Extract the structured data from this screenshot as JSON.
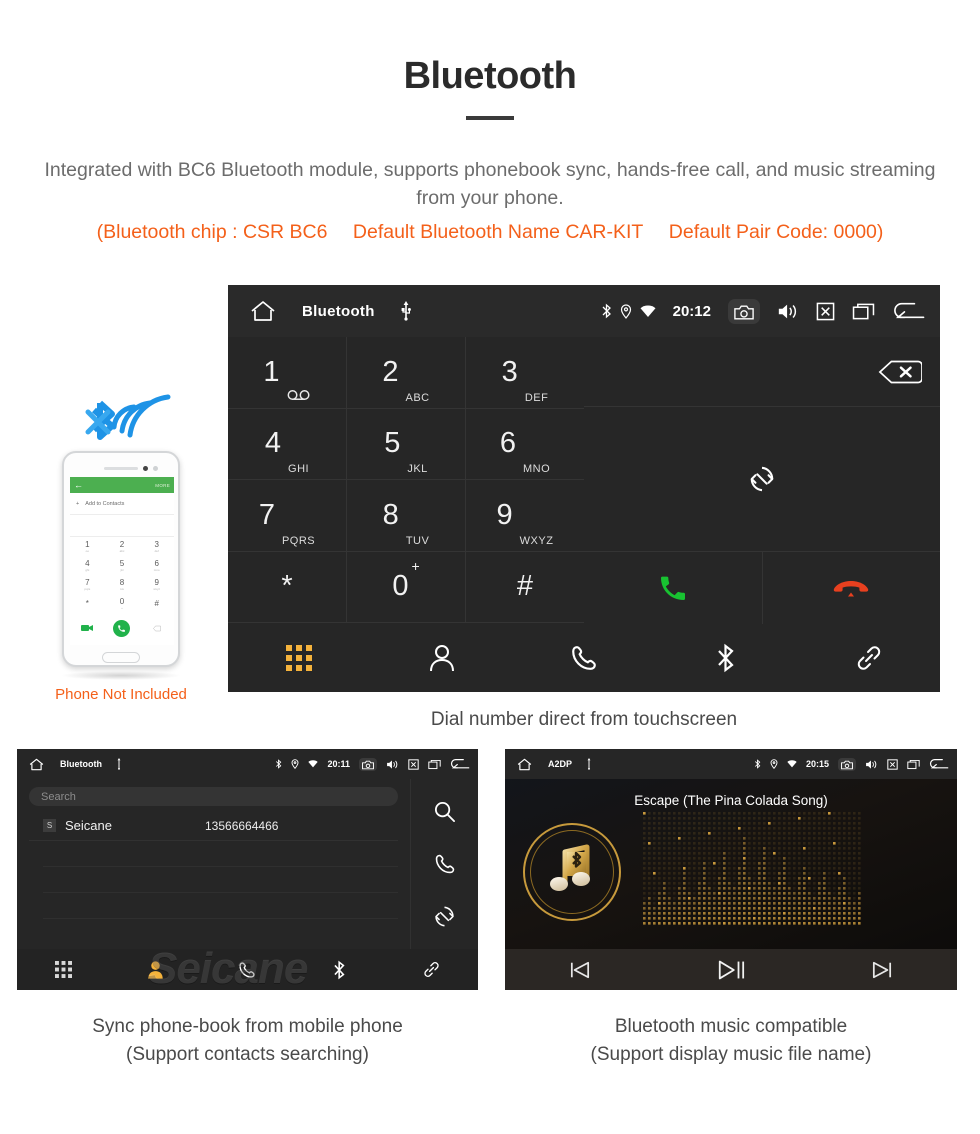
{
  "header": {
    "title": "Bluetooth",
    "subtitle": "Integrated with BC6 Bluetooth module, supports phonebook sync, hands-free call, and music streaming from your phone.",
    "note_chip": "(Bluetooth chip : CSR BC6",
    "note_name": "Default Bluetooth Name CAR-KIT",
    "note_pair": "Default Pair Code: 0000)",
    "accent_color": "#f4601a",
    "text_color": "#6c6c6c"
  },
  "main_unit": {
    "statusbar": {
      "home_icon": "home-icon",
      "title": "Bluetooth",
      "usb_icon": "usb-icon",
      "bluetooth_icon": "bluetooth-icon",
      "location_icon": "location-icon",
      "wifi_icon": "wifi-icon",
      "time": "20:12",
      "camera_icon": "camera-icon",
      "volume_icon": "speaker-icon",
      "close_icon": "close-box-icon",
      "recents_icon": "recents-icon",
      "back_icon": "back-arrow-icon"
    },
    "keys": [
      {
        "num": "1",
        "sub": "",
        "voicemail": true
      },
      {
        "num": "2",
        "sub": "ABC"
      },
      {
        "num": "3",
        "sub": "DEF"
      },
      {
        "num": "4",
        "sub": "GHI"
      },
      {
        "num": "5",
        "sub": "JKL"
      },
      {
        "num": "6",
        "sub": "MNO"
      },
      {
        "num": "7",
        "sub": "PQRS"
      },
      {
        "num": "8",
        "sub": "TUV"
      },
      {
        "num": "9",
        "sub": "WXYZ"
      },
      {
        "num": "*",
        "sub": ""
      },
      {
        "num": "0",
        "sub": "",
        "plus": "+"
      },
      {
        "num": "#",
        "sub": ""
      }
    ],
    "right_pad": {
      "backspace_icon": "backspace-icon",
      "sync_icon": "sync-icon",
      "call_icon": "call-icon",
      "hangup_icon": "hangup-icon",
      "call_color": "#18c231",
      "hangup_color": "#e8401f"
    },
    "tabs": [
      {
        "name": "dialpad",
        "icon": "dialpad-icon",
        "active": true
      },
      {
        "name": "contacts",
        "icon": "person-icon",
        "active": false
      },
      {
        "name": "call-log",
        "icon": "phone-icon",
        "active": false
      },
      {
        "name": "bluetooth",
        "icon": "bluetooth-icon",
        "active": false
      },
      {
        "name": "link",
        "icon": "link-icon",
        "active": false
      }
    ],
    "active_color": "#f5b33c",
    "caption": "Dial number direct from touchscreen"
  },
  "phone_mockup": {
    "bluetooth_wave_color": "#1e93e6",
    "app_back_icon": "back-icon",
    "app_more_label": "MORE",
    "add_contacts_label": "Add to Contacts",
    "add_icon": "plus-icon",
    "keys": [
      {
        "num": "1",
        "sub": "oo"
      },
      {
        "num": "2",
        "sub": "abc"
      },
      {
        "num": "3",
        "sub": "def"
      },
      {
        "num": "4",
        "sub": "ghi"
      },
      {
        "num": "5",
        "sub": "jkl"
      },
      {
        "num": "6",
        "sub": "mno"
      },
      {
        "num": "7",
        "sub": "pqrs"
      },
      {
        "num": "8",
        "sub": "tuv"
      },
      {
        "num": "9",
        "sub": "wxyz"
      },
      {
        "num": "*",
        "sub": ""
      },
      {
        "num": "0",
        "sub": "+"
      },
      {
        "num": "#",
        "sub": ""
      }
    ],
    "caption": "Phone Not Included",
    "caption_color": "#f4601a"
  },
  "bottom_left": {
    "statusbar": {
      "home_icon": "home-icon",
      "title": "Bluetooth",
      "usb_icon": "usb-icon",
      "time": "20:11",
      "camera_icon": "camera-icon",
      "volume_icon": "speaker-icon",
      "close_icon": "close-box-icon",
      "recents_icon": "recents-icon",
      "back_icon": "back-arrow-icon"
    },
    "search_placeholder": "Search",
    "contacts": [
      {
        "initial": "S",
        "name": "Seicane",
        "number": "13566664466"
      }
    ],
    "side_actions": [
      {
        "name": "search",
        "icon": "search-icon"
      },
      {
        "name": "call",
        "icon": "phone-icon"
      },
      {
        "name": "sync",
        "icon": "sync-icon"
      }
    ],
    "tabs": [
      {
        "name": "dialpad",
        "icon": "dialpad-icon",
        "active": false
      },
      {
        "name": "contacts",
        "icon": "person-icon",
        "active": true
      },
      {
        "name": "call-log",
        "icon": "phone-icon",
        "active": false
      },
      {
        "name": "bluetooth",
        "icon": "bluetooth-icon",
        "active": false
      },
      {
        "name": "link",
        "icon": "link-icon",
        "active": false
      }
    ],
    "caption_line1": "Sync phone-book from mobile phone",
    "caption_line2": "(Support contacts searching)"
  },
  "bottom_right": {
    "statusbar": {
      "home_icon": "home-icon",
      "title": "A2DP",
      "usb_icon": "usb-icon",
      "time": "20:15",
      "camera_icon": "camera-icon",
      "volume_icon": "speaker-icon",
      "close_icon": "close-box-icon",
      "recents_icon": "recents-icon",
      "back_icon": "back-arrow-icon"
    },
    "song_title": "Escape (The Pina Colada Song)",
    "album_icon": "music-note-bluetooth-icon",
    "transport": [
      {
        "name": "previous",
        "icon": "previous-track-icon"
      },
      {
        "name": "play-pause",
        "icon": "play-pause-icon"
      },
      {
        "name": "next",
        "icon": "next-track-icon"
      }
    ],
    "accent_color": "#d2a03f",
    "caption_line1": "Bluetooth music compatible",
    "caption_line2": "(Support display music file name)"
  },
  "watermark": {
    "text": "Seicane"
  }
}
